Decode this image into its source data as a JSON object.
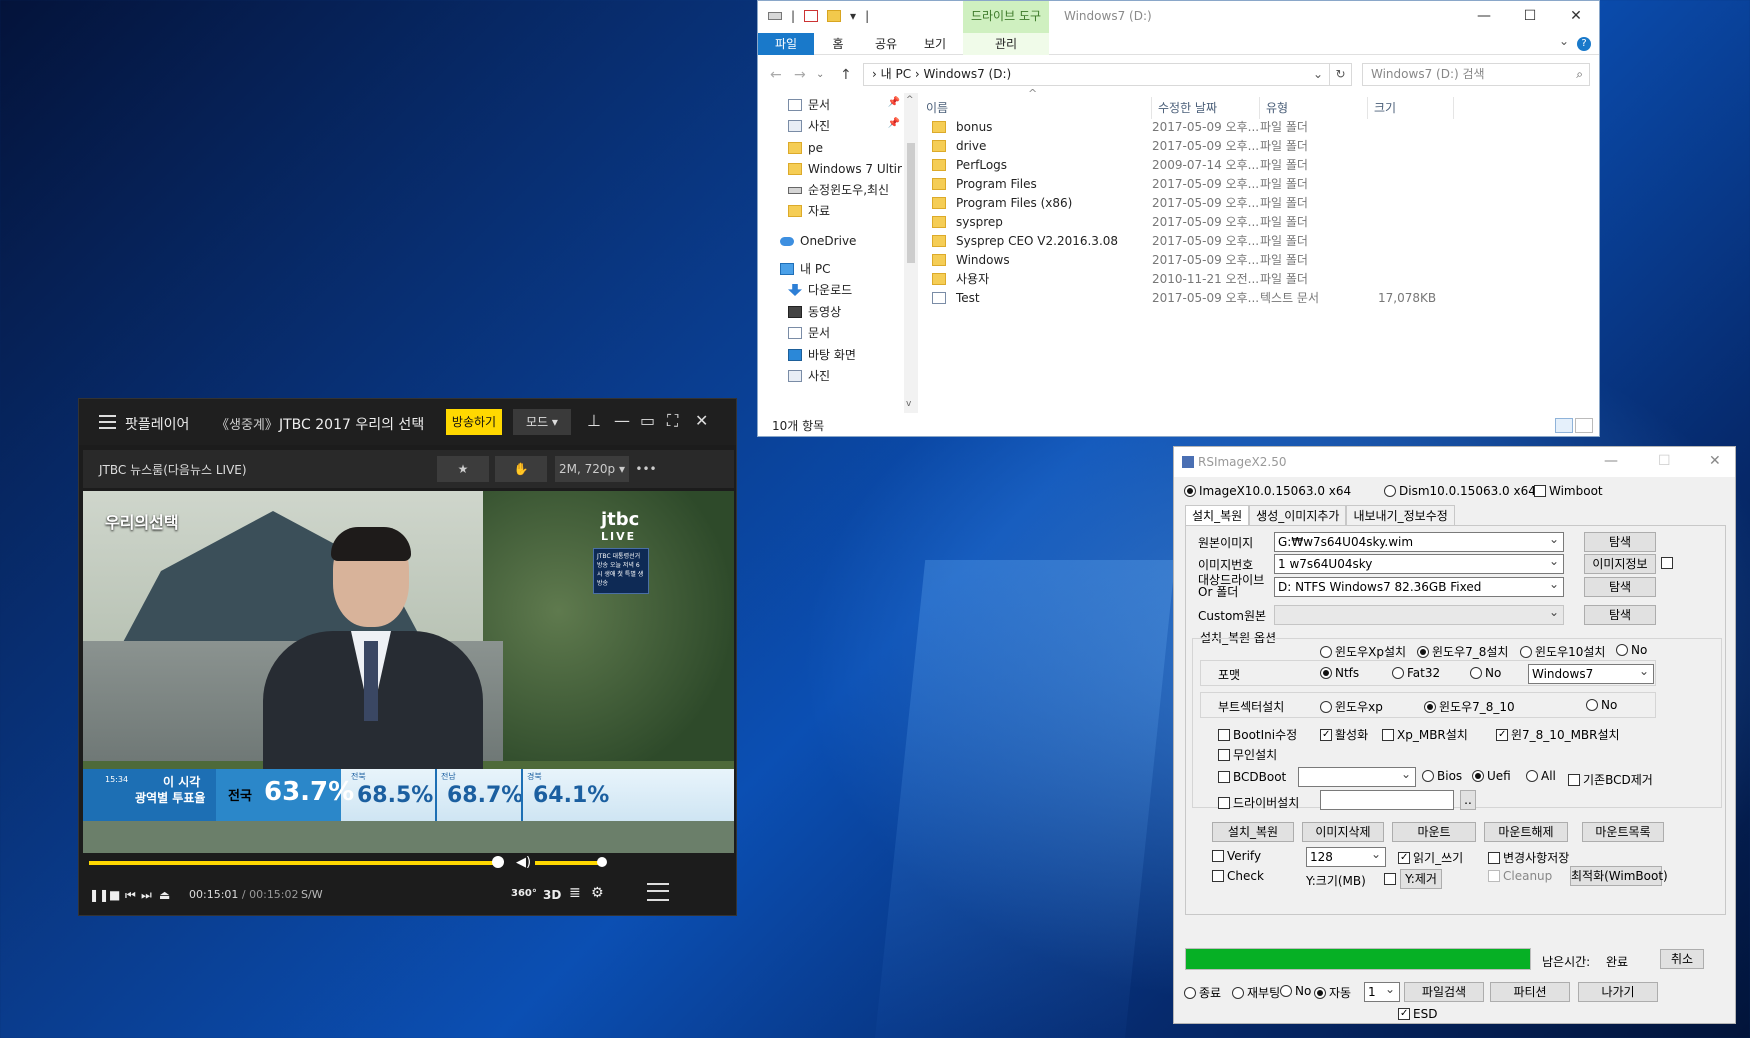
{
  "explorer": {
    "qat_sep": "|",
    "qat_arrow": "▾",
    "context_tab": "드라이브 도구",
    "title": "Windows7 (D:)",
    "window_controls": [
      "—",
      "☐",
      "✕"
    ],
    "ribbon_tabs": [
      "파일",
      "홈",
      "공유",
      "보기"
    ],
    "ribbon_context": "관리",
    "ribbon_expand": "⌄",
    "help": "?",
    "nav_arrows": [
      "←",
      "→",
      "⌄",
      "↑"
    ],
    "address": "›  내 PC  ›  Windows7 (D:)",
    "address_dropdown": "⌄",
    "refresh": "↻",
    "search_placeholder": "Windows7 (D:) 검색",
    "search_icon": "⌕",
    "sort_indicator": "^",
    "scroll_arrows": [
      "^",
      "v"
    ],
    "nav_pin": "📌",
    "nav_items": [
      {
        "label": "문서",
        "icon": "document-icon",
        "pinned": true
      },
      {
        "label": "사진",
        "icon": "pictures-icon",
        "pinned": true
      },
      {
        "label": "pe",
        "icon": "folder-icon"
      },
      {
        "label": "Windows 7 Ultir",
        "icon": "folder-icon"
      },
      {
        "label": "순정윈도우,최신",
        "icon": "drive-icon"
      },
      {
        "label": "자료",
        "icon": "folder-icon"
      },
      {
        "label": "OneDrive",
        "icon": "onedrive-icon"
      },
      {
        "label": "내 PC",
        "icon": "this-pc-icon"
      },
      {
        "label": "다운로드",
        "icon": "downloads-icon"
      },
      {
        "label": "동영상",
        "icon": "videos-icon"
      },
      {
        "label": "문서",
        "icon": "document-icon"
      },
      {
        "label": "바탕 화면",
        "icon": "desktop-icon"
      },
      {
        "label": "사진",
        "icon": "pictures-icon"
      }
    ],
    "columns": [
      "이름",
      "수정한 날짜",
      "유형",
      "크기"
    ],
    "files": [
      {
        "name": "bonus",
        "date": "2017-05-09 오후...",
        "type": "파일 폴더",
        "size": ""
      },
      {
        "name": "drive",
        "date": "2017-05-09 오후...",
        "type": "파일 폴더",
        "size": ""
      },
      {
        "name": "PerfLogs",
        "date": "2009-07-14 오후...",
        "type": "파일 폴더",
        "size": ""
      },
      {
        "name": "Program Files",
        "date": "2017-05-09 오후...",
        "type": "파일 폴더",
        "size": ""
      },
      {
        "name": "Program Files (x86)",
        "date": "2017-05-09 오후...",
        "type": "파일 폴더",
        "size": ""
      },
      {
        "name": "sysprep",
        "date": "2017-05-09 오후...",
        "type": "파일 폴더",
        "size": ""
      },
      {
        "name": "Sysprep CEO V2.2016.3.08",
        "date": "2017-05-09 오후...",
        "type": "파일 폴더",
        "size": ""
      },
      {
        "name": "Windows",
        "date": "2017-05-09 오후...",
        "type": "파일 폴더",
        "size": ""
      },
      {
        "name": "사용자",
        "date": "2010-11-21 오전...",
        "type": "파일 폴더",
        "size": ""
      },
      {
        "name": "Test",
        "date": "2017-05-09 오후...",
        "type": "텍스트 문서",
        "size": "17,078KB"
      }
    ],
    "status": "10개 항목"
  },
  "player": {
    "app_name": "팟플레이어",
    "live_tag": "《생중계》",
    "show_title": "JTBC 2017 우리의 선택",
    "broadcast_button": "방송하기",
    "mode_button": "모드 ▾",
    "title_controls": [
      "⊥",
      "—",
      "▭",
      "⛶",
      "✕"
    ],
    "channel": "JTBC 뉴스룸(다음뉴스 LIVE)",
    "info_buttons": [
      "★",
      "✋",
      "2M, 720p ▾",
      "•••"
    ],
    "video_overlay_title": "우리의선택",
    "video_logo": "jtbc",
    "video_logo_sub": "LIVE",
    "video_badge": "JTBC 대통령선거 방송 오늘 저녁 6시 생애 첫 특별 생방송",
    "ticker": {
      "time": "15:34",
      "line1": "이 시각",
      "line2": "광역별 투표율",
      "national_label": "전국",
      "national_value": "63.7%",
      "regions": [
        {
          "name": "전북",
          "value": "68.5%"
        },
        {
          "name": "전남",
          "value": "68.7%"
        },
        {
          "name": "경북",
          "value": "64.1%"
        }
      ]
    },
    "seek_fraction": 0.998,
    "volume_fraction": 0.95,
    "vol_icon": "◀)",
    "buttons": [
      "❚❚",
      "■",
      "⏮",
      "⏭",
      "⏏"
    ],
    "time_current": "00:15:01",
    "time_sep": " / ",
    "time_total": "00:15:02",
    "codec": "S/W",
    "right_buttons": [
      "360°",
      "3D",
      "≣",
      "⚙"
    ]
  },
  "rsx": {
    "title": "RSImageX2.50",
    "window_controls": [
      "—",
      "☐",
      "✕"
    ],
    "top_options": [
      {
        "label": "ImageX10.0.15063.0 x64",
        "checked": true
      },
      {
        "label": "Dism10.0.15063.0 x64",
        "checked": false
      },
      {
        "label": "Wimboot",
        "checked": false
      }
    ],
    "tabs": [
      "설치_복원",
      "생성_이미지추가",
      "내보내기_정보수정"
    ],
    "source_label": "원본이미지",
    "source_value": "G:₩w7s64U04sky.wim",
    "browse": "탐색",
    "index_label": "이미지번호",
    "index_value": "1  w7s64U04sky",
    "image_info": "이미지정보",
    "target_label_1": "대상드라이브",
    "target_label_2": "Or 폴더",
    "target_value": "D:  NTFS  Windows7    82.36GB  Fixed",
    "custom_label": "Custom원본",
    "options_title": "설치_복원 옵션",
    "os_options": [
      {
        "label": "윈도우Xp설치",
        "checked": false
      },
      {
        "label": "윈도우7_8설치",
        "checked": true
      },
      {
        "label": "윈도우10설치",
        "checked": false
      },
      {
        "label": "No",
        "checked": false
      }
    ],
    "format_label": "포맷",
    "format_options": [
      {
        "label": "Ntfs",
        "checked": true
      },
      {
        "label": "Fat32",
        "checked": false
      },
      {
        "label": "No",
        "checked": false
      }
    ],
    "volume_label": "Windows7",
    "boot_label": "부트섹터설치",
    "boot_options": [
      {
        "label": "윈도우xp",
        "checked": false
      },
      {
        "label": "윈도우7_8_10",
        "checked": true
      },
      {
        "label": "No",
        "checked": false
      }
    ],
    "checks_row1": [
      {
        "label": "BootIni수정",
        "checked": false
      },
      {
        "label": "활성화",
        "checked": true
      },
      {
        "label": "Xp_MBR설치",
        "checked": false
      },
      {
        "label": "윈7_8_10_MBR설치",
        "checked": true
      }
    ],
    "unattended": "무인설치",
    "bcdboot": "BCDBoot",
    "bcd_options": [
      {
        "label": "Bios",
        "checked": false
      },
      {
        "label": "Uefi",
        "checked": true
      },
      {
        "label": "All",
        "checked": false
      }
    ],
    "bcd_remove": "기존BCD제거",
    "driver_install": "드라이버설치",
    "dots": "..",
    "action_buttons": [
      "설치_복원",
      "이미지삭제",
      "마운트",
      "마운트해제",
      "마운트목록"
    ],
    "verify": "Verify",
    "check": "Check",
    "size_value": "128",
    "size_label": "Y:크기(MB)",
    "read_write": "읽기_쓰기",
    "y_remove": "Y:제거",
    "save_changes": "변경사항저장",
    "cleanup": "Cleanup",
    "optimize": "최적화(WimBoot)",
    "progress_fraction": 1.0,
    "remaining_label": "남은시간:",
    "remaining_value": "완료",
    "cancel": "취소",
    "end_options": [
      {
        "label": "종료",
        "checked": false
      },
      {
        "label": "재부팅",
        "checked": false
      },
      {
        "label": "No",
        "checked": false
      },
      {
        "label": "자동",
        "checked": true
      }
    ],
    "end_combo": "1",
    "file_search": "파일검색",
    "partition": "파티션",
    "exit": "나가기",
    "esd": "ESD"
  }
}
